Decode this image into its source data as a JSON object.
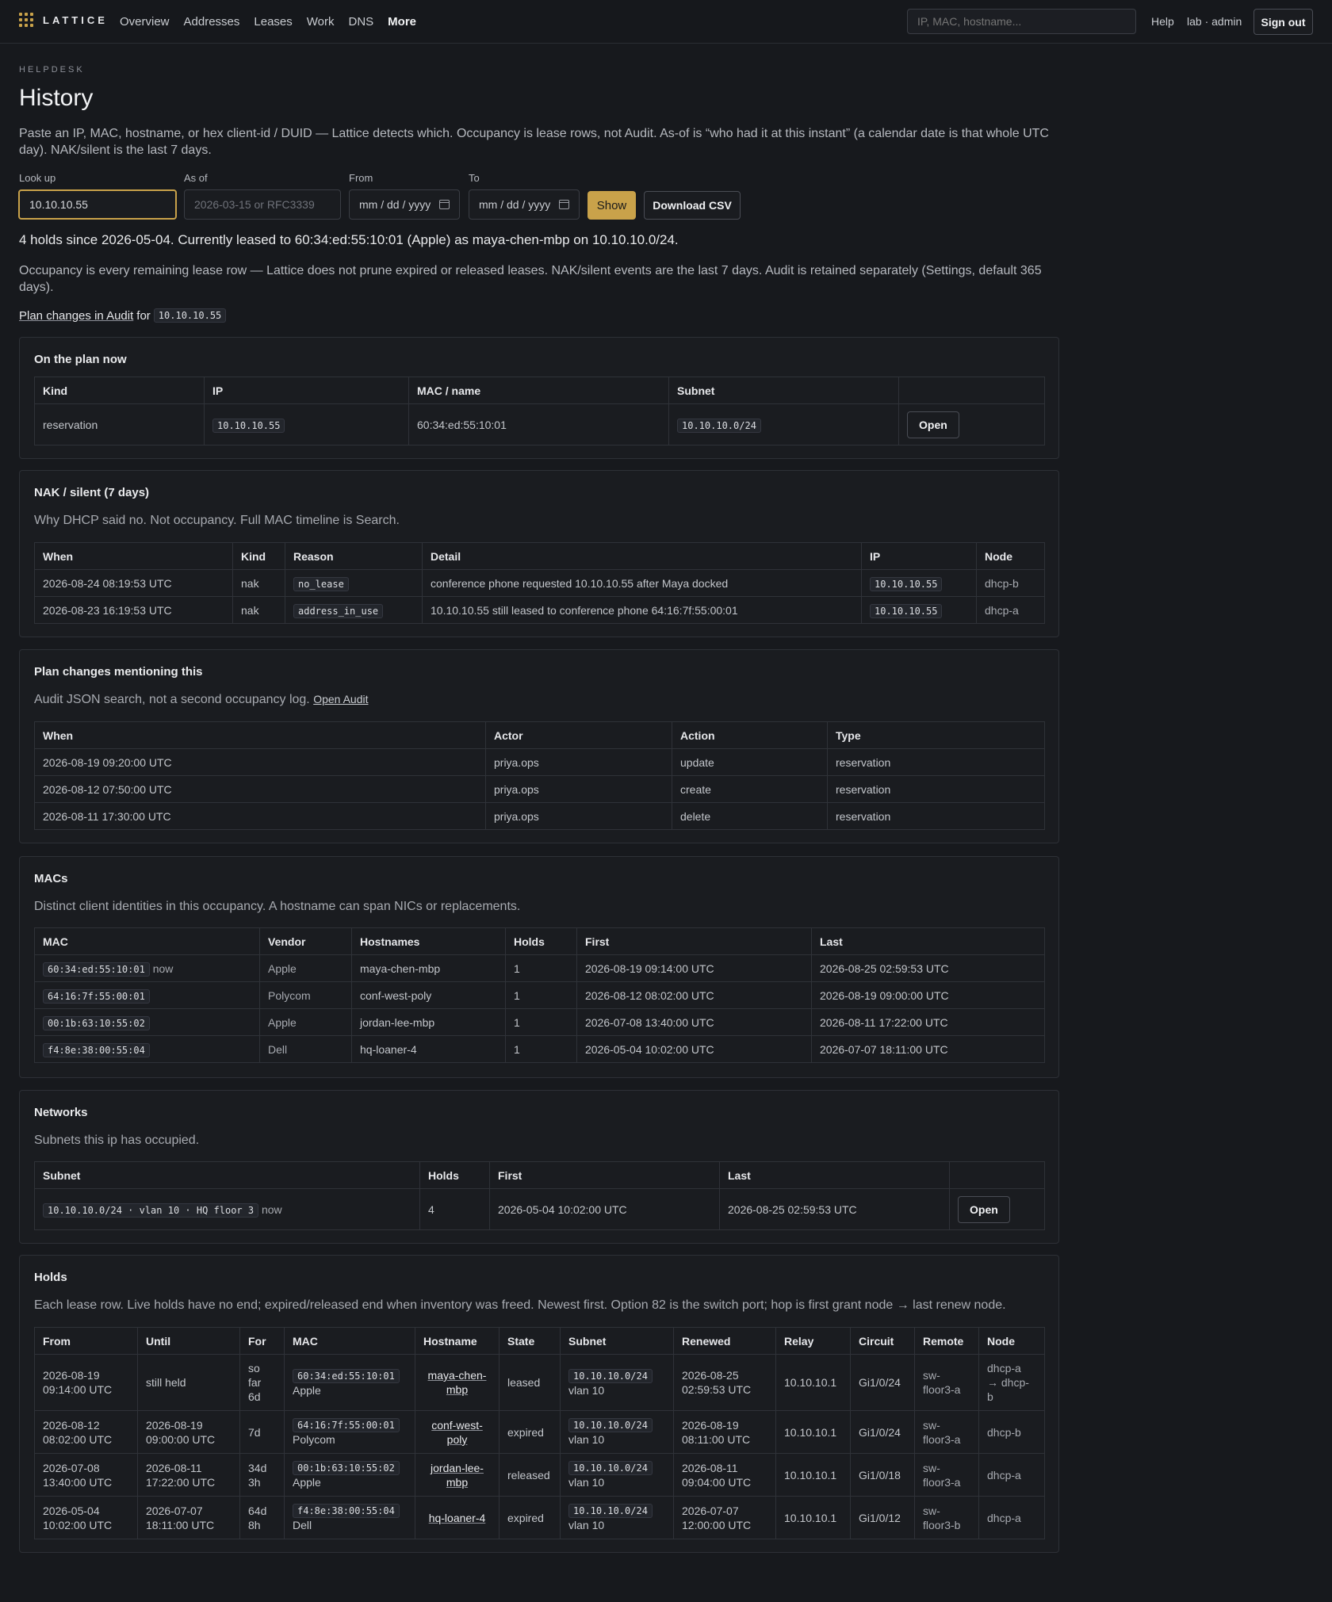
{
  "topbar": {
    "logo": "LATTICE",
    "nav": [
      "Overview",
      "Addresses",
      "Leases",
      "Work",
      "DNS",
      "More"
    ],
    "search_placeholder": "IP, MAC, hostname...",
    "help": "Help",
    "user": "lab · admin",
    "signout": "Sign out"
  },
  "header": {
    "eyebrow": "HELPDESK",
    "title": "History",
    "intro": "Paste an IP, MAC, hostname, or hex client-id / DUID — Lattice detects which. Occupancy is lease rows, not Audit. As-of is “who had it at this instant” (a calendar date is that whole UTC day). NAK/silent is the last 7 days."
  },
  "form": {
    "lookup_label": "Look up",
    "lookup_value": "10.10.10.55",
    "asof_label": "As of",
    "asof_placeholder": "2026-03-15 or RFC3339",
    "from_label": "From",
    "from_value": "mm / dd / yyyy",
    "to_label": "To",
    "to_value": "mm / dd / yyyy",
    "show": "Show",
    "csv": "Download CSV"
  },
  "summary": "4 holds since 2026-05-04. Currently leased to 60:34:ed:55:10:01 (Apple) as maya-chen-mbp on 10.10.10.0/24.",
  "note": "Occupancy is every remaining lease row — Lattice does not prune expired or released leases. NAK/silent events are the last 7 days. Audit is retained separately (Settings, default 365 days).",
  "plan_link": {
    "text": "Plan changes in Audit",
    "for": "for",
    "ip": "10.10.10.55"
  },
  "plan_now": {
    "title": "On the plan now",
    "headers": [
      "Kind",
      "IP",
      "MAC / name",
      "Subnet",
      ""
    ],
    "row": {
      "kind": "reservation",
      "ip": "10.10.10.55",
      "mac": "60:34:ed:55:10:01",
      "subnet": "10.10.10.0/24",
      "action": "Open"
    }
  },
  "nak": {
    "title": "NAK / silent (7 days)",
    "desc": "Why DHCP said no. Not occupancy. Full MAC timeline is Search.",
    "headers": [
      "When",
      "Kind",
      "Reason",
      "Detail",
      "IP",
      "Node"
    ],
    "rows": [
      {
        "when": "2026-08-24 08:19:53 UTC",
        "kind": "nak",
        "reason": "no_lease",
        "detail": "conference phone requested 10.10.10.55 after Maya docked",
        "ip": "10.10.10.55",
        "node": "dhcp-b"
      },
      {
        "when": "2026-08-23 16:19:53 UTC",
        "kind": "nak",
        "reason": "address_in_use",
        "detail": "10.10.10.55 still leased to conference phone 64:16:7f:55:00:01",
        "ip": "10.10.10.55",
        "node": "dhcp-a"
      }
    ]
  },
  "plan_changes": {
    "title": "Plan changes mentioning this",
    "desc": "Audit JSON search, not a second occupancy log.",
    "desc_link": "Open Audit",
    "headers": [
      "When",
      "Actor",
      "Action",
      "Type"
    ],
    "rows": [
      {
        "when": "2026-08-19 09:20:00 UTC",
        "actor": "priya.ops",
        "action": "update",
        "type": "reservation"
      },
      {
        "when": "2026-08-12 07:50:00 UTC",
        "actor": "priya.ops",
        "action": "create",
        "type": "reservation"
      },
      {
        "when": "2026-08-11 17:30:00 UTC",
        "actor": "priya.ops",
        "action": "delete",
        "type": "reservation"
      }
    ]
  },
  "macs": {
    "title": "MACs",
    "desc": "Distinct client identities in this occupancy. A hostname can span NICs or replacements.",
    "headers": [
      "MAC",
      "Vendor",
      "Hostnames",
      "Holds",
      "First",
      "Last"
    ],
    "now_label": "now",
    "rows": [
      {
        "mac": "60:34:ed:55:10:01",
        "now": "now",
        "vendor": "Apple",
        "hostnames": "maya-chen-mbp",
        "holds": "1",
        "first": "2026-08-19 09:14:00 UTC",
        "last": "2026-08-25 02:59:53 UTC"
      },
      {
        "mac": "64:16:7f:55:00:01",
        "now": "",
        "vendor": "Polycom",
        "hostnames": "conf-west-poly",
        "holds": "1",
        "first": "2026-08-12 08:02:00 UTC",
        "last": "2026-08-19 09:00:00 UTC"
      },
      {
        "mac": "00:1b:63:10:55:02",
        "now": "",
        "vendor": "Apple",
        "hostnames": "jordan-lee-mbp",
        "holds": "1",
        "first": "2026-07-08 13:40:00 UTC",
        "last": "2026-08-11 17:22:00 UTC"
      },
      {
        "mac": "f4:8e:38:00:55:04",
        "now": "",
        "vendor": "Dell",
        "hostnames": "hq-loaner-4",
        "holds": "1",
        "first": "2026-05-04 10:02:00 UTC",
        "last": "2026-07-07 18:11:00 UTC"
      }
    ]
  },
  "networks": {
    "title": "Networks",
    "desc": "Subnets this ip has occupied.",
    "headers": [
      "Subnet",
      "Holds",
      "First",
      "Last",
      ""
    ],
    "row": {
      "subnet": "10.10.10.0/24 · vlan 10 · HQ floor 3",
      "now": "now",
      "holds": "4",
      "first": "2026-05-04 10:02:00 UTC",
      "last": "2026-08-25 02:59:53 UTC",
      "action": "Open"
    }
  },
  "holds": {
    "title": "Holds",
    "desc": "Each lease row. Live holds have no end; expired/released end when inventory was freed. Newest first. Option 82 is the switch port; hop is first grant node → last renew node.",
    "headers": [
      "From",
      "Until",
      "For",
      "MAC",
      "Hostname",
      "State",
      "Subnet",
      "Renewed",
      "Relay",
      "Circuit",
      "Remote",
      "Node"
    ],
    "rows": [
      {
        "from1": "2026-08-19",
        "from2": "09:14:00 UTC",
        "until1": "still held",
        "until2": "",
        "for1": "so",
        "for2": "far",
        "for3": "6d",
        "mac": "60:34:ed:55:10:01",
        "vendor": "Apple",
        "host1": "maya-chen-",
        "host2": "mbp",
        "state": "leased",
        "subnet": "10.10.10.0/24",
        "vlan": "vlan 10",
        "ren1": "2026-08-25",
        "ren2": "02:59:53 UTC",
        "relay": "10.10.10.1",
        "circuit": "Gi1/0/24",
        "rem1": "sw-",
        "rem2": "floor3-a",
        "node1": "dhcp-a",
        "node2": "→ dhcp-",
        "node3": "b"
      },
      {
        "from1": "2026-08-12",
        "from2": "08:02:00 UTC",
        "until1": "2026-08-19",
        "until2": "09:00:00 UTC",
        "for1": "7d",
        "for2": "",
        "for3": "",
        "mac": "64:16:7f:55:00:01",
        "vendor": "Polycom",
        "host1": "conf-west-",
        "host2": "poly",
        "state": "expired",
        "subnet": "10.10.10.0/24",
        "vlan": "vlan 10",
        "ren1": "2026-08-19",
        "ren2": "08:11:00 UTC",
        "relay": "10.10.10.1",
        "circuit": "Gi1/0/24",
        "rem1": "sw-",
        "rem2": "floor3-a",
        "node1": "dhcp-b",
        "node2": "",
        "node3": ""
      },
      {
        "from1": "2026-07-08",
        "from2": "13:40:00 UTC",
        "until1": "2026-08-11",
        "until2": "17:22:00 UTC",
        "for1": "34d",
        "for2": "3h",
        "for3": "",
        "mac": "00:1b:63:10:55:02",
        "vendor": "Apple",
        "host1": "jordan-lee-",
        "host2": "mbp",
        "state": "released",
        "subnet": "10.10.10.0/24",
        "vlan": "vlan 10",
        "ren1": "2026-08-11",
        "ren2": "09:04:00 UTC",
        "relay": "10.10.10.1",
        "circuit": "Gi1/0/18",
        "rem1": "sw-",
        "rem2": "floor3-a",
        "node1": "dhcp-a",
        "node2": "",
        "node3": ""
      },
      {
        "from1": "2026-05-04",
        "from2": "10:02:00 UTC",
        "until1": "2026-07-07",
        "until2": "18:11:00 UTC",
        "for1": "64d",
        "for2": "8h",
        "for3": "",
        "mac": "f4:8e:38:00:55:04",
        "vendor": "Dell",
        "host1": "hq-loaner-4",
        "host2": "",
        "state": "expired",
        "subnet": "10.10.10.0/24",
        "vlan": "vlan 10",
        "ren1": "2026-07-07",
        "ren2": "12:00:00 UTC",
        "relay": "10.10.10.1",
        "circuit": "Gi1/0/12",
        "rem1": "sw-",
        "rem2": "floor3-b",
        "node1": "dhcp-a",
        "node2": "",
        "node3": ""
      }
    ]
  }
}
